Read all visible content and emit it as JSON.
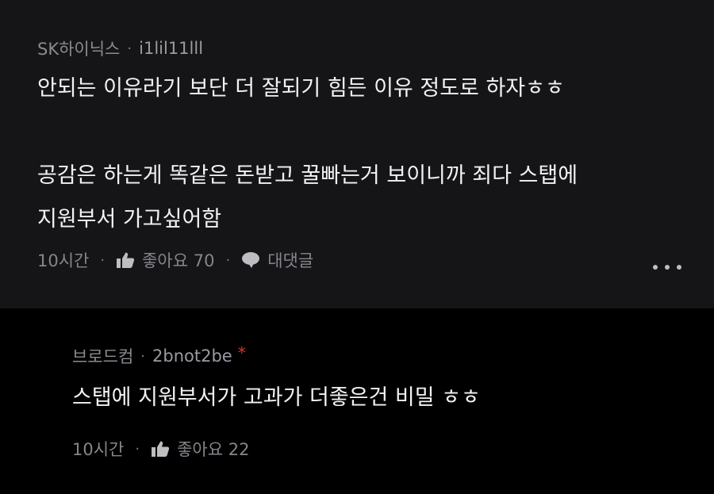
{
  "top_comment": {
    "author": "SK하이닉스",
    "user_id": "i1lil11lll",
    "lines": [
      "안되는 이유라기 보단 더 잘되기 힘든 이유 정도로 하자ㅎㅎ",
      "",
      "공감은 하는게 똑같은 돈받고 꿀빠는거 보이니까 죄다 스탭에",
      "지원부서 가고싶어함"
    ],
    "time": "10시간",
    "like_label": "좋아요 70",
    "reply_label": "대댓글",
    "more_icon": "more-horizontal-icon"
  },
  "reply_comment": {
    "author": "브로드컴",
    "user_id": "2bnot2be",
    "badge": "*",
    "lines": [
      "스탭에 지원부서가 고과가 더좋은건 비밀 ㅎㅎ"
    ],
    "time": "10시간",
    "like_label": "좋아요 22"
  },
  "separator": "·",
  "colors": {
    "top_background": "#151518",
    "reply_background": "#000000",
    "badge": "#e0322e"
  }
}
